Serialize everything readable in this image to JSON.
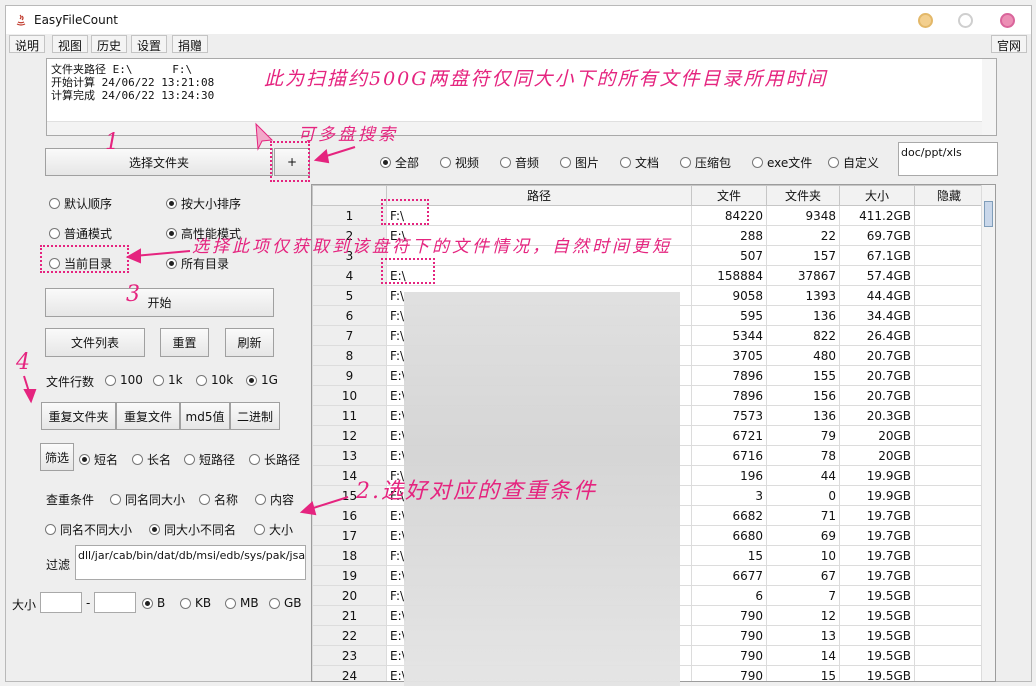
{
  "window": {
    "title": "EasyFileCount"
  },
  "menu": {
    "items": [
      "说明",
      "视图",
      "历史",
      "设置",
      "捐赠"
    ],
    "right": "官网"
  },
  "info": {
    "lines": [
      "文件夹路径 E:\\      F:\\",
      "开始计算 24/06/22 13:21:08",
      "计算完成 24/06/22 13:24:30"
    ]
  },
  "buttons": {
    "select_folder": "选择文件夹",
    "add": "+",
    "start": "开始",
    "file_list": "文件列表",
    "reset": "重置",
    "refresh": "刷新",
    "dup_folder": "重复文件夹",
    "dup_file": "重复文件",
    "md5": "md5值",
    "binary": "二进制",
    "filter": "筛选"
  },
  "sort": {
    "default": "默认顺序",
    "by_size": "按大小排序"
  },
  "mode": {
    "normal": "普通模式",
    "high": "高性能模式"
  },
  "scope": {
    "current": "当前目录",
    "all": "所有目录"
  },
  "file_lines": {
    "label": "文件行数",
    "options": [
      "100",
      "1k",
      "10k",
      "1G"
    ],
    "selected": "1G"
  },
  "name_type": {
    "options": [
      "短名",
      "长名",
      "短路径",
      "长路径"
    ],
    "selected": "短名"
  },
  "dup_cond": {
    "label": "查重条件",
    "options": [
      "同名同大小",
      "名称",
      "内容",
      "同名不同大小",
      "同大小不同名",
      "大小"
    ],
    "selected": "同大小不同名"
  },
  "exclude": {
    "label": "过滤",
    "value": "dll/jar/cab/bin/dat/db/msi/edb/sys/pak/jsa"
  },
  "size_filter": {
    "label": "大小",
    "dash": "-",
    "units": [
      "B",
      "KB",
      "MB",
      "GB"
    ],
    "selected": "B"
  },
  "type_filter": {
    "options": [
      "全部",
      "视频",
      "音频",
      "图片",
      "文档",
      "压缩包",
      "exe文件",
      "自定义"
    ],
    "selected": "全部",
    "custom_value": "doc/ppt/xls"
  },
  "table": {
    "headers": [
      "",
      "路径",
      "文件",
      "文件夹",
      "大小",
      "隐藏"
    ],
    "rows": [
      [
        "1",
        "F:\\",
        "84220",
        "9348",
        "411.2GB",
        ""
      ],
      [
        "2",
        "E:\\",
        "288",
        "22",
        "69.7GB",
        ""
      ],
      [
        "3",
        "",
        "507",
        "157",
        "67.1GB",
        ""
      ],
      [
        "4",
        "E:\\",
        "158884",
        "37867",
        "57.4GB",
        ""
      ],
      [
        "5",
        "F:\\",
        "9058",
        "1393",
        "44.4GB",
        ""
      ],
      [
        "6",
        "F:\\",
        "595",
        "136",
        "34.4GB",
        ""
      ],
      [
        "7",
        "F:\\",
        "5344",
        "822",
        "26.4GB",
        ""
      ],
      [
        "8",
        "F:\\",
        "3705",
        "480",
        "20.7GB",
        ""
      ],
      [
        "9",
        "E:\\",
        "7896",
        "155",
        "20.7GB",
        ""
      ],
      [
        "10",
        "E:\\",
        "7896",
        "156",
        "20.7GB",
        ""
      ],
      [
        "11",
        "E:\\",
        "7573",
        "136",
        "20.3GB",
        ""
      ],
      [
        "12",
        "E:\\",
        "6721",
        "79",
        "20GB",
        ""
      ],
      [
        "13",
        "E:\\",
        "6716",
        "78",
        "20GB",
        ""
      ],
      [
        "14",
        "F:\\",
        "196",
        "44",
        "19.9GB",
        ""
      ],
      [
        "15",
        "F:\\",
        "3",
        "0",
        "19.9GB",
        ""
      ],
      [
        "16",
        "E:\\",
        "6682",
        "71",
        "19.7GB",
        ""
      ],
      [
        "17",
        "E:\\",
        "6680",
        "69",
        "19.7GB",
        ""
      ],
      [
        "18",
        "F:\\",
        "15",
        "10",
        "19.7GB",
        ""
      ],
      [
        "19",
        "E:\\",
        "6677",
        "67",
        "19.7GB",
        ""
      ],
      [
        "20",
        "F:\\",
        "6",
        "7",
        "19.5GB",
        ""
      ],
      [
        "21",
        "E:\\",
        "790",
        "12",
        "19.5GB",
        ""
      ],
      [
        "22",
        "E:\\",
        "790",
        "13",
        "19.5GB",
        ""
      ],
      [
        "23",
        "E:\\",
        "790",
        "14",
        "19.5GB",
        ""
      ],
      [
        "24",
        "E:\\",
        "790",
        "15",
        "19.5GB",
        ""
      ]
    ]
  },
  "annotations": {
    "top": "此为扫描约500G两盘符仅同大小下的所有文件目录所用时间",
    "multi": "可多盘搜索",
    "n1": "1",
    "n2": "2.选好对应的查重条件",
    "n3": "3",
    "n4": "4",
    "current_note": "选择此项仅获取到该盘符下的文件情况，自然时间更短"
  },
  "colors": {
    "annotation": "#e5247f"
  }
}
